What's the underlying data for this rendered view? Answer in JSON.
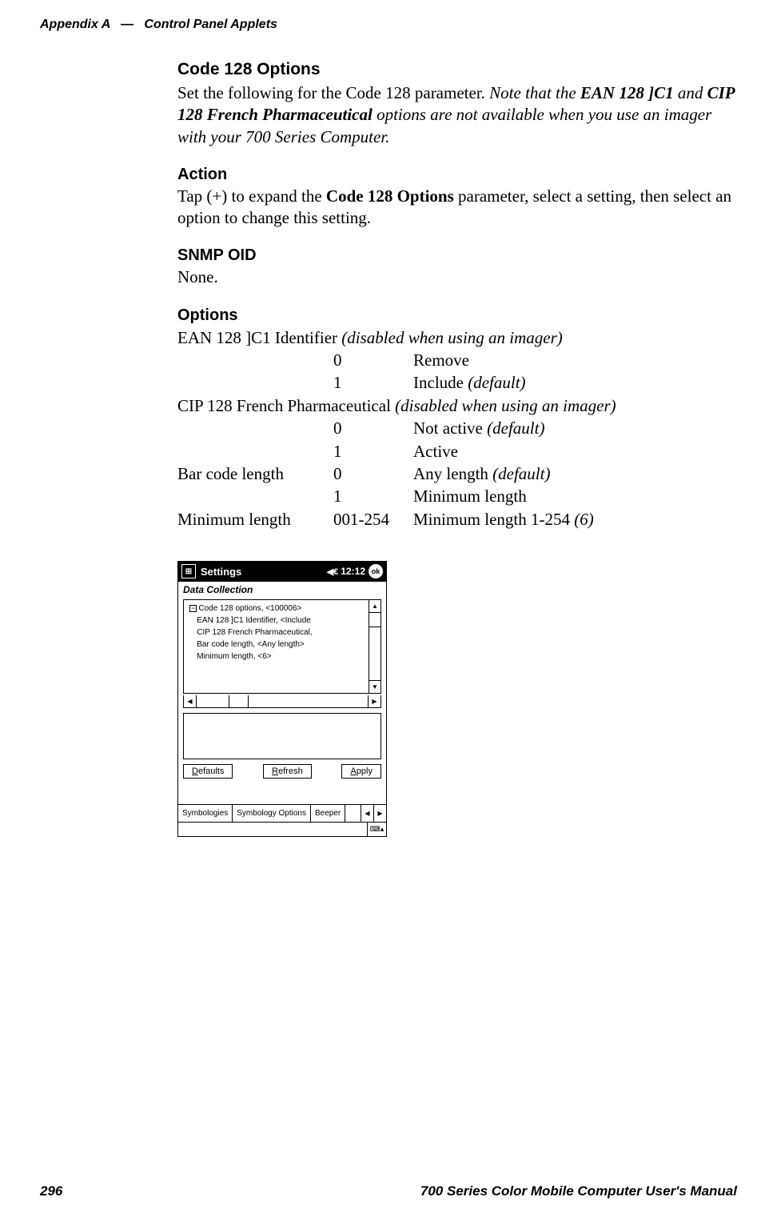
{
  "header": {
    "appendix": "Appendix  A",
    "separator": "—",
    "section": "Control Panel Applets"
  },
  "main": {
    "title": "Code 128 Options",
    "intro_plain": "Set the following for the Code 128 parameter. ",
    "intro_italic_1": "Note that the ",
    "intro_bold_italic_1": "EAN 128 ]C1",
    "intro_italic_2": " and ",
    "intro_bold_italic_2": "CIP 128 French Pharmaceutical",
    "intro_italic_3": " options are not available when you use an imager with your 700 Series Computer.",
    "action_heading": "Action",
    "action_p1": "Tap (+) to expand the ",
    "action_bold": "Code 128 Options",
    "action_p2": " parameter, select a setting, then select an option to change this setting.",
    "snmp_heading": "SNMP OID",
    "snmp_value": "None.",
    "options_heading": "Options",
    "ean_label": "EAN 128 ]C1 Identifier ",
    "ean_note": "(disabled when using an imager)",
    "ean_row0_code": "0",
    "ean_row0_desc": "Remove",
    "ean_row1_code": "1",
    "ean_row1_desc": "Include ",
    "ean_row1_note": "(default)",
    "cip_label": "CIP 128 French Pharmaceutical ",
    "cip_note": "(disabled when using an imager)",
    "cip_row0_code": "0",
    "cip_row0_desc": "Not active ",
    "cip_row0_note": "(default)",
    "cip_row1_code": "1",
    "cip_row1_desc": "Active",
    "bcl_label": "Bar code length",
    "bcl_row0_code": "0",
    "bcl_row0_desc": "Any length ",
    "bcl_row0_note": "(default)",
    "bcl_row1_code": "1",
    "bcl_row1_desc": "Minimum length",
    "min_label": "Minimum length",
    "min_code": "001-254",
    "min_desc": "Minimum length 1-254 ",
    "min_note": "(6)"
  },
  "screenshot": {
    "title": "Settings",
    "time": "12:12",
    "ok": "ok",
    "subtitle": "Data Collection",
    "tree": {
      "line1": "Code 128 options, <100006>",
      "line2": "EAN 128 ]C1 Identifier, <Include",
      "line3": "CIP 128 French Pharmaceutical,",
      "line4": "Bar code length, <Any length>",
      "line5": "Minimum length, <6>"
    },
    "buttons": {
      "defaults": "efaults",
      "defaults_u": "D",
      "refresh": "efresh",
      "refresh_u": "R",
      "apply": "pply",
      "apply_u": "A"
    },
    "tabs": {
      "t1": "Symbologies",
      "t2": "Symbology Options",
      "t3": "Beeper"
    }
  },
  "footer": {
    "page": "296",
    "text": "700 Series Color Mobile Computer User's Manual"
  }
}
